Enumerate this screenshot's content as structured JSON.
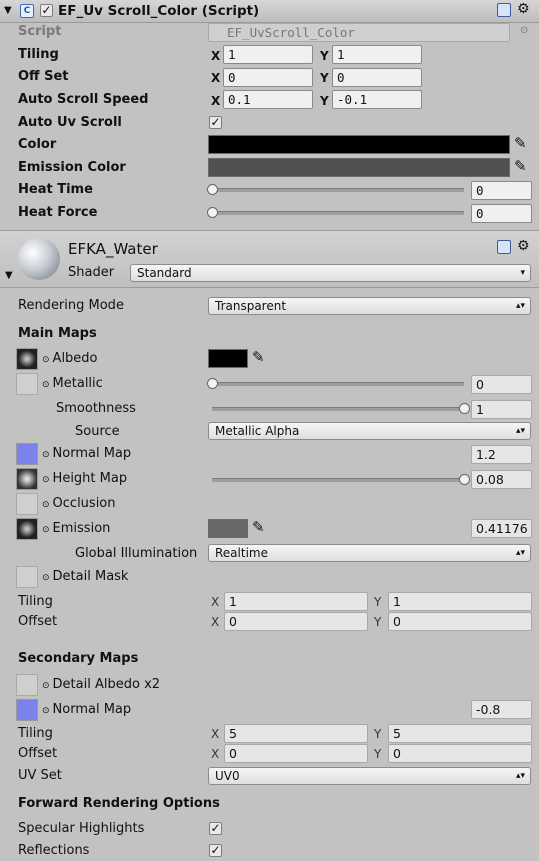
{
  "script_component": {
    "title": "EF_Uv Scroll_Color (Script)",
    "script_label": "Script",
    "script_value": "EF_UvScroll_Color",
    "tiling_label": "Tiling",
    "tiling_x": "1",
    "tiling_y": "1",
    "offset_label": "Off Set",
    "offset_x": "0",
    "offset_y": "0",
    "speed_label": "Auto Scroll Speed",
    "speed_x": "0.1",
    "speed_y": "-0.1",
    "auto_uv_label": "Auto Uv Scroll",
    "color_label": "Color",
    "color_value": "#000000",
    "emission_color_label": "Emission Color",
    "emission_color_value": "#505050",
    "heat_time_label": "Heat Time",
    "heat_time_value": "0",
    "heat_force_label": "Heat Force",
    "heat_force_value": "0"
  },
  "axis": {
    "x": "X",
    "y": "Y"
  },
  "material": {
    "name": "EFKA_Water",
    "shader_label": "Shader",
    "shader_value": "Standard",
    "rendering_mode_label": "Rendering Mode",
    "rendering_mode_value": "Transparent",
    "main_maps_heading": "Main Maps",
    "albedo_label": "Albedo",
    "metallic_label": "Metallic",
    "metallic_value": "0",
    "smoothness_label": "Smoothness",
    "smoothness_value": "1",
    "source_label": "Source",
    "source_value": "Metallic Alpha",
    "normal_map_label": "Normal Map",
    "normal_map_value": "1.2",
    "height_map_label": "Height Map",
    "height_map_value": "0.08",
    "occlusion_label": "Occlusion",
    "emission_label": "Emission",
    "emission_value": "0.41176",
    "gi_label": "Global Illumination",
    "gi_value": "Realtime",
    "detail_mask_label": "Detail Mask",
    "tiling_label": "Tiling",
    "tiling_x": "1",
    "tiling_y": "1",
    "offset_label": "Offset",
    "offset_x": "0",
    "offset_y": "0",
    "secondary_heading": "Secondary Maps",
    "detail_albedo_label": "Detail Albedo x2",
    "sec_normal_label": "Normal Map",
    "sec_normal_value": "-0.8",
    "sec_tiling_label": "Tiling",
    "sec_tiling_x": "5",
    "sec_tiling_y": "5",
    "sec_offset_label": "Offset",
    "sec_offset_x": "0",
    "sec_offset_y": "0",
    "uvset_label": "UV Set",
    "uvset_value": "UV0",
    "forward_heading": "Forward Rendering Options",
    "specular_label": "Specular Highlights",
    "reflections_label": "Reflections"
  },
  "sliders": {
    "heat_time": 0,
    "heat_force": 0,
    "metallic": 0,
    "smoothness": 1,
    "height_map": 1
  }
}
